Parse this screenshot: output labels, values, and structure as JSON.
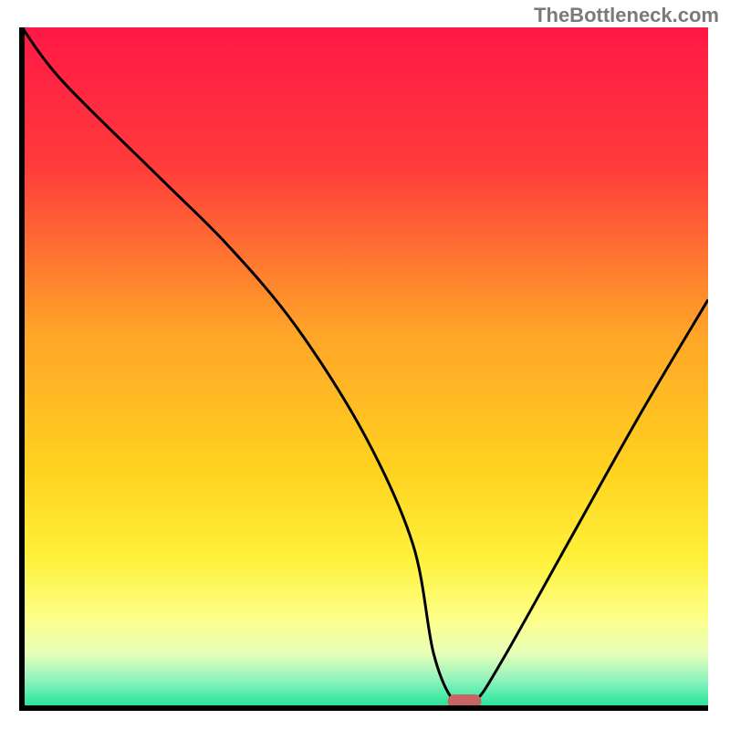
{
  "watermark": "TheBottleneck.com",
  "chart_data": {
    "type": "line",
    "title": "",
    "xlabel": "",
    "ylabel": "",
    "xlim": [
      0,
      100
    ],
    "ylim": [
      0,
      100
    ],
    "series": [
      {
        "name": "bottleneck-curve",
        "x": [
          0,
          6,
          20,
          30,
          40,
          50,
          57,
          60,
          63,
          66,
          70,
          80,
          90,
          100
        ],
        "y": [
          100,
          92,
          78,
          68,
          56,
          40,
          24,
          8,
          1,
          1,
          7,
          25,
          43,
          60
        ]
      }
    ],
    "marker": {
      "x": 64.5,
      "y": 1
    },
    "gradient_stops": [
      {
        "offset": 0,
        "color": "#ff1846"
      },
      {
        "offset": 20,
        "color": "#ff3a3b"
      },
      {
        "offset": 45,
        "color": "#ffa528"
      },
      {
        "offset": 65,
        "color": "#ffd21f"
      },
      {
        "offset": 78,
        "color": "#fff13a"
      },
      {
        "offset": 87,
        "color": "#fdff8a"
      },
      {
        "offset": 92,
        "color": "#e6ffb8"
      },
      {
        "offset": 96,
        "color": "#8cf2be"
      },
      {
        "offset": 100,
        "color": "#19e597"
      }
    ],
    "axes_color": "#000000",
    "background": "#ffffff",
    "marker_fill": "#c86464",
    "marker_stroke": "#c86464"
  }
}
